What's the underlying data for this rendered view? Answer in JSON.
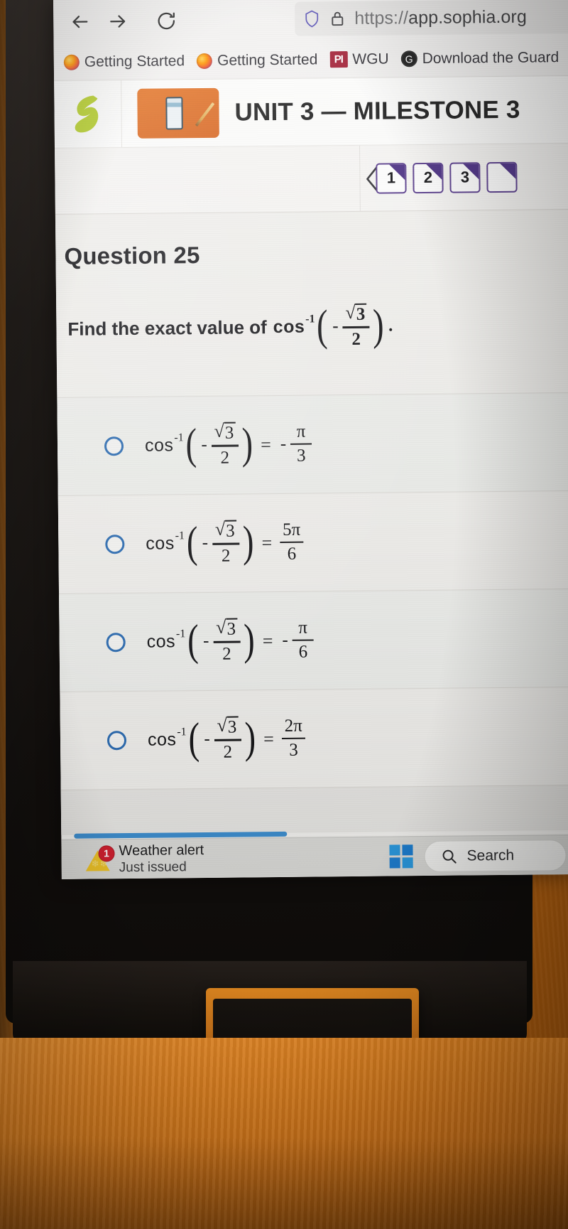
{
  "browser": {
    "back_icon": "back-arrow-icon",
    "forward_icon": "forward-arrow-icon",
    "reload_icon": "reload-icon",
    "shield_icon": "shield-icon",
    "lock_icon": "padlock-icon",
    "url_protocol": "https://",
    "url_host": "app.sophia.org",
    "bookmarks": [
      {
        "label": "Getting Started",
        "icon": "firefox-icon"
      },
      {
        "label": "Getting Started",
        "icon": "firefox-icon"
      },
      {
        "label": "WGU",
        "icon": "pi-icon",
        "icon_text": "PI"
      },
      {
        "label": "Download the Guard",
        "icon": "guardian-icon",
        "icon_text": "G"
      }
    ]
  },
  "app": {
    "logo_name": "sophia-logo",
    "unit_icon_name": "unit-thumbnail-icon",
    "title": "UNIT 3 — MILESTONE 3"
  },
  "pager": {
    "prev_icon": "chevron-left-icon",
    "pages": [
      "1",
      "2",
      "3"
    ],
    "accent_color": "#4e3386"
  },
  "question": {
    "heading": "Question 25",
    "prompt_text": "Find the exact value of",
    "prompt_expression": {
      "fn": "cos",
      "exponent": "-1",
      "arg_sign": "-",
      "arg_numerator": "3",
      "arg_denominator": "2",
      "arg_radical": "√"
    },
    "prompt_period": ".",
    "options": [
      {
        "id": "option-a",
        "fn": "cos",
        "exponent": "-1",
        "arg_sign": "-",
        "arg_numerator": "3",
        "arg_denominator": "2",
        "equals": "=",
        "result_sign": "-",
        "result_numerator": "π",
        "result_denominator": "3",
        "selected": false
      },
      {
        "id": "option-b",
        "fn": "cos",
        "exponent": "-1",
        "arg_sign": "-",
        "arg_numerator": "3",
        "arg_denominator": "2",
        "equals": "=",
        "result_sign": "",
        "result_numerator": "5π",
        "result_denominator": "6",
        "selected": false
      },
      {
        "id": "option-c",
        "fn": "cos",
        "exponent": "-1",
        "arg_sign": "-",
        "arg_numerator": "3",
        "arg_denominator": "2",
        "equals": "=",
        "result_sign": "-",
        "result_numerator": "π",
        "result_denominator": "6",
        "selected": false
      },
      {
        "id": "option-d",
        "fn": "cos",
        "exponent": "-1",
        "arg_sign": "-",
        "arg_numerator": "3",
        "arg_denominator": "2",
        "equals": "=",
        "result_sign": "",
        "result_numerator": "2π",
        "result_denominator": "3",
        "selected": false
      }
    ]
  },
  "taskbar": {
    "weather_badge": "1",
    "weather_title": "Weather alert",
    "weather_sub": "Just issued",
    "weather_icon": "weather-alert-icon",
    "start_icon": "windows-start-icon",
    "search_icon": "search-icon",
    "search_label": "Search"
  },
  "scrollbar": {
    "color": "#3f8fd0"
  }
}
